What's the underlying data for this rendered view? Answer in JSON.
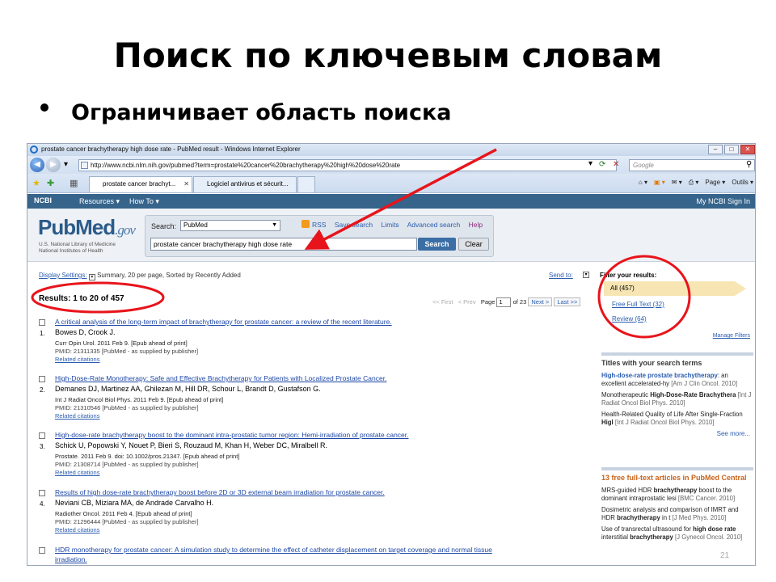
{
  "slide": {
    "title": "Поиск по ключевым словам",
    "bullet": "Ограничивает область поиска",
    "page_number": "21"
  },
  "browser": {
    "window_title": "prostate cancer brachytherapy high dose rate - PubMed result - Windows Internet Explorer",
    "url": "http://www.ncbi.nlm.nih.gov/pubmed?term=prostate%20cancer%20brachytherapy%20high%20dose%20rate",
    "search_placeholder": "Google",
    "tabs": [
      {
        "label": "prostate cancer brachyt...",
        "active": true
      },
      {
        "label": "Logiciel antivirus et sécurit...",
        "active": false
      }
    ],
    "command_bar": [
      "Page ▾",
      "Outils ▾"
    ]
  },
  "ncbi": {
    "logo": "NCBI",
    "menu": [
      "Resources",
      "How To"
    ],
    "right": "My NCBI  Sign In"
  },
  "pubmed": {
    "logo_main": "PubMed",
    "logo_gov": ".gov",
    "subtitle_1": "U.S. National Library of Medicine",
    "subtitle_2": "National Institutes of Health",
    "search_label": "Search:",
    "database": "PubMed",
    "links": {
      "rss": "RSS",
      "save": "Save search",
      "limits": "Limits",
      "advanced": "Advanced search",
      "help": "Help"
    },
    "query": "prostate cancer brachytherapy high dose rate",
    "search_button": "Search",
    "clear_button": "Clear"
  },
  "results_header": {
    "display_settings": "Display Settings:",
    "summary": "Summary, 20 per page, Sorted by Recently Added",
    "send_to": "Send to:",
    "count": "Results: 1 to 20 of 457",
    "pager": {
      "first": "<< First",
      "prev": "< Prev",
      "page_label": "Page",
      "page": "1",
      "of": "of 23",
      "next": "Next >",
      "last": "Last >>"
    }
  },
  "results": [
    {
      "num": "1.",
      "title": "A critical analysis of the long-term impact of brachytherapy for prostate cancer: a review of the recent literature.",
      "authors": "Bowes D, Crook J.",
      "journal": "Curr Opin Urol. 2011 Feb 9. [Epub ahead of print]",
      "pmid": "PMID: 21311335 [PubMed - as supplied by publisher]",
      "related": "Related citations"
    },
    {
      "num": "2.",
      "title": "High-Dose-Rate Monotherapy: Safe and Effective Brachytherapy for Patients with Localized Prostate Cancer.",
      "authors": "Demanes DJ, Martinez AA, Ghilezan M, Hill DR, Schour L, Brandt D, Gustafson G.",
      "journal": "Int J Radiat Oncol Biol Phys. 2011 Feb 9. [Epub ahead of print]",
      "pmid": "PMID: 21310546 [PubMed - as supplied by publisher]",
      "related": "Related citations"
    },
    {
      "num": "3.",
      "title": "High-dose-rate brachytherapy boost to the dominant intra-prostatic tumor region: Hemi-irradiation of prostate cancer.",
      "authors": "Schick U, Popowski Y, Nouet P, Bieri S, Rouzaud M, Khan H, Weber DC, Miralbell R.",
      "journal": "Prostate. 2011 Feb 9. doi: 10.1002/pros.21347. [Epub ahead of print]",
      "pmid": "PMID: 21308714 [PubMed - as supplied by publisher]",
      "related": "Related citations"
    },
    {
      "num": "4.",
      "title": "Results of high dose-rate brachytherapy boost before 2D or 3D external beam irradiation for prostate cancer.",
      "authors": "Neviani CB, Miziara MA, de Andrade Carvalho H.",
      "journal": "Radiother Oncol. 2011 Feb 4. [Epub ahead of print]",
      "pmid": "PMID: 21296444 [PubMed - as supplied by publisher]",
      "related": "Related citations"
    },
    {
      "num": "5.",
      "title": "HDR monotherapy for prostate cancer: A simulation study to determine the effect of catheter displacement on target coverage and normal tissue",
      "title_2": "irradiation.",
      "authors": "",
      "journal": "",
      "pmid": "",
      "related": ""
    }
  ],
  "sidebar": {
    "filter_heading": "Filter your results:",
    "filters": [
      "All (457)",
      "Free Full Text (32)",
      "Review (64)"
    ],
    "manage_filters": "Manage Filters",
    "titles_panel": {
      "heading": "Titles with your search terms",
      "items": [
        {
          "bold": "High-dose-rate prostate brachytherapy",
          "rest": ": an excellent accelerated-hy",
          "src": "[Am J Clin Oncol. 2010]"
        },
        {
          "pre": "Monotherapeutic ",
          "bold": "High-Dose-Rate Brachythera",
          "src": "[Int J Radiat Oncol Biol Phys. 2010]"
        },
        {
          "pre": "Health-Related Quality of Life After Single-Fraction ",
          "bold": "Higl",
          "src": "[Int J Radiat Oncol Biol Phys. 2010]"
        }
      ],
      "see_more": "See more..."
    },
    "free_panel": {
      "heading": "13 free full-text articles in PubMed Central",
      "items": [
        {
          "pre": "MRS-guided HDR ",
          "bold": "brachytherapy",
          "rest": " boost to the dominant intraprostatic lesi",
          "src": "[BMC Cancer. 2010]"
        },
        {
          "pre": "Dosimetric analysis and comparison of IMRT and HDR ",
          "bold": "brachytherapy",
          "rest": " in t",
          "src": "[J Med Phys. 2010]"
        },
        {
          "pre": "Use of transrectal ultrasound for ",
          "bold": "high dose rate",
          "rest": " interstitial ",
          "bold2": "brachytherapy",
          "src": "[J Gynecol Oncol. 2010]"
        }
      ]
    }
  },
  "colors": {
    "annotation_red": "#e8141b",
    "ncbi_blue": "#36648b",
    "link_blue": "#1d47a6"
  }
}
